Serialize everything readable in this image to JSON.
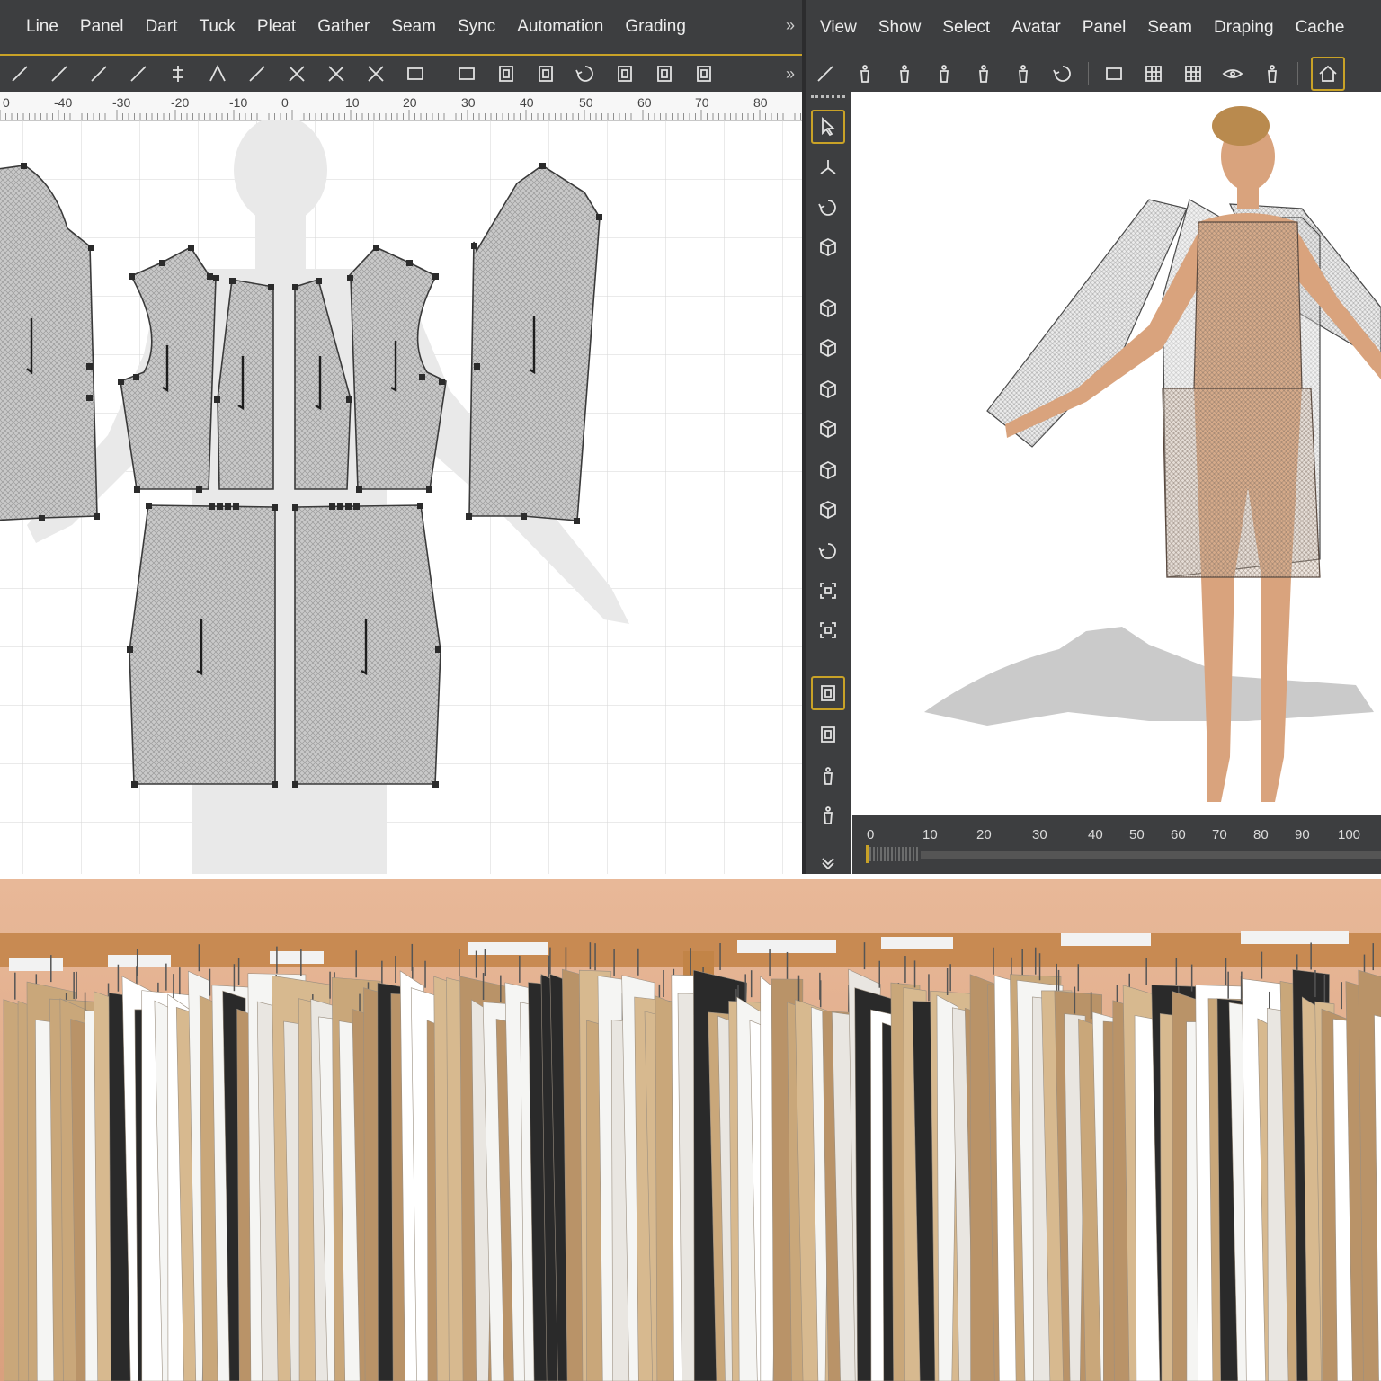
{
  "pattern_editor": {
    "menu": [
      "Line",
      "Panel",
      "Dart",
      "Tuck",
      "Pleat",
      "Gather",
      "Seam",
      "Sync",
      "Automation",
      "Grading"
    ],
    "overflow_glyph": "»",
    "toolbar_icons": [
      "segment-icon",
      "curve-point-icon",
      "line-angle-icon",
      "line-point-icon",
      "split-icon",
      "notch-icon",
      "point-n-icon",
      "cross-point-icon",
      "scale-point-icon",
      "intersect-icon",
      "rectangle-icon",
      "panel-fill-icon",
      "panel-inner-icon",
      "panel-edit-icon",
      "rotate-icon",
      "panel-flip-icon",
      "panel-copy-icon",
      "panel-stack-icon"
    ],
    "ruler_ticks": [
      "0",
      "-40",
      "-30",
      "-20",
      "-10",
      "0",
      "10",
      "20",
      "30",
      "40",
      "50",
      "60",
      "70",
      "80"
    ]
  },
  "view3d": {
    "menu": [
      "View",
      "Show",
      "Select",
      "Avatar",
      "Panel",
      "Seam",
      "Draping",
      "Cache"
    ],
    "toolbar_icons": [
      "reset-view-icon",
      "garment-icon",
      "body-front-icon",
      "body-side-icon",
      "body-back-icon",
      "body-three-quarter-icon",
      "refresh-icon",
      "front-view-icon",
      "grid-view-icon",
      "stretch-icon",
      "eye-icon",
      "avatar-a-icon",
      "home-icon"
    ],
    "side_tools": [
      "select-arrow-icon",
      "transform-icon",
      "rotate-icon",
      "cylinder-icon",
      "cube-front-icon",
      "cube-back-icon",
      "cube-left-icon",
      "cube-right-icon",
      "cube-top-icon",
      "cube-bottom-icon",
      "orbit-icon",
      "fit-view-icon",
      "snapshot-icon",
      "panel-select-icon",
      "panel-arrange-icon",
      "avatar-select-icon",
      "avatar-point-icon",
      "more-icon"
    ],
    "timeline_ticks": [
      "0",
      "10",
      "20",
      "30",
      "40",
      "50",
      "60",
      "70",
      "80",
      "90",
      "100"
    ]
  },
  "colors": {
    "toolbar_bg": "#3d3e40",
    "accent": "#c9a227",
    "panel_fill": "#cfcfcf",
    "skin": "#d9a37d"
  }
}
